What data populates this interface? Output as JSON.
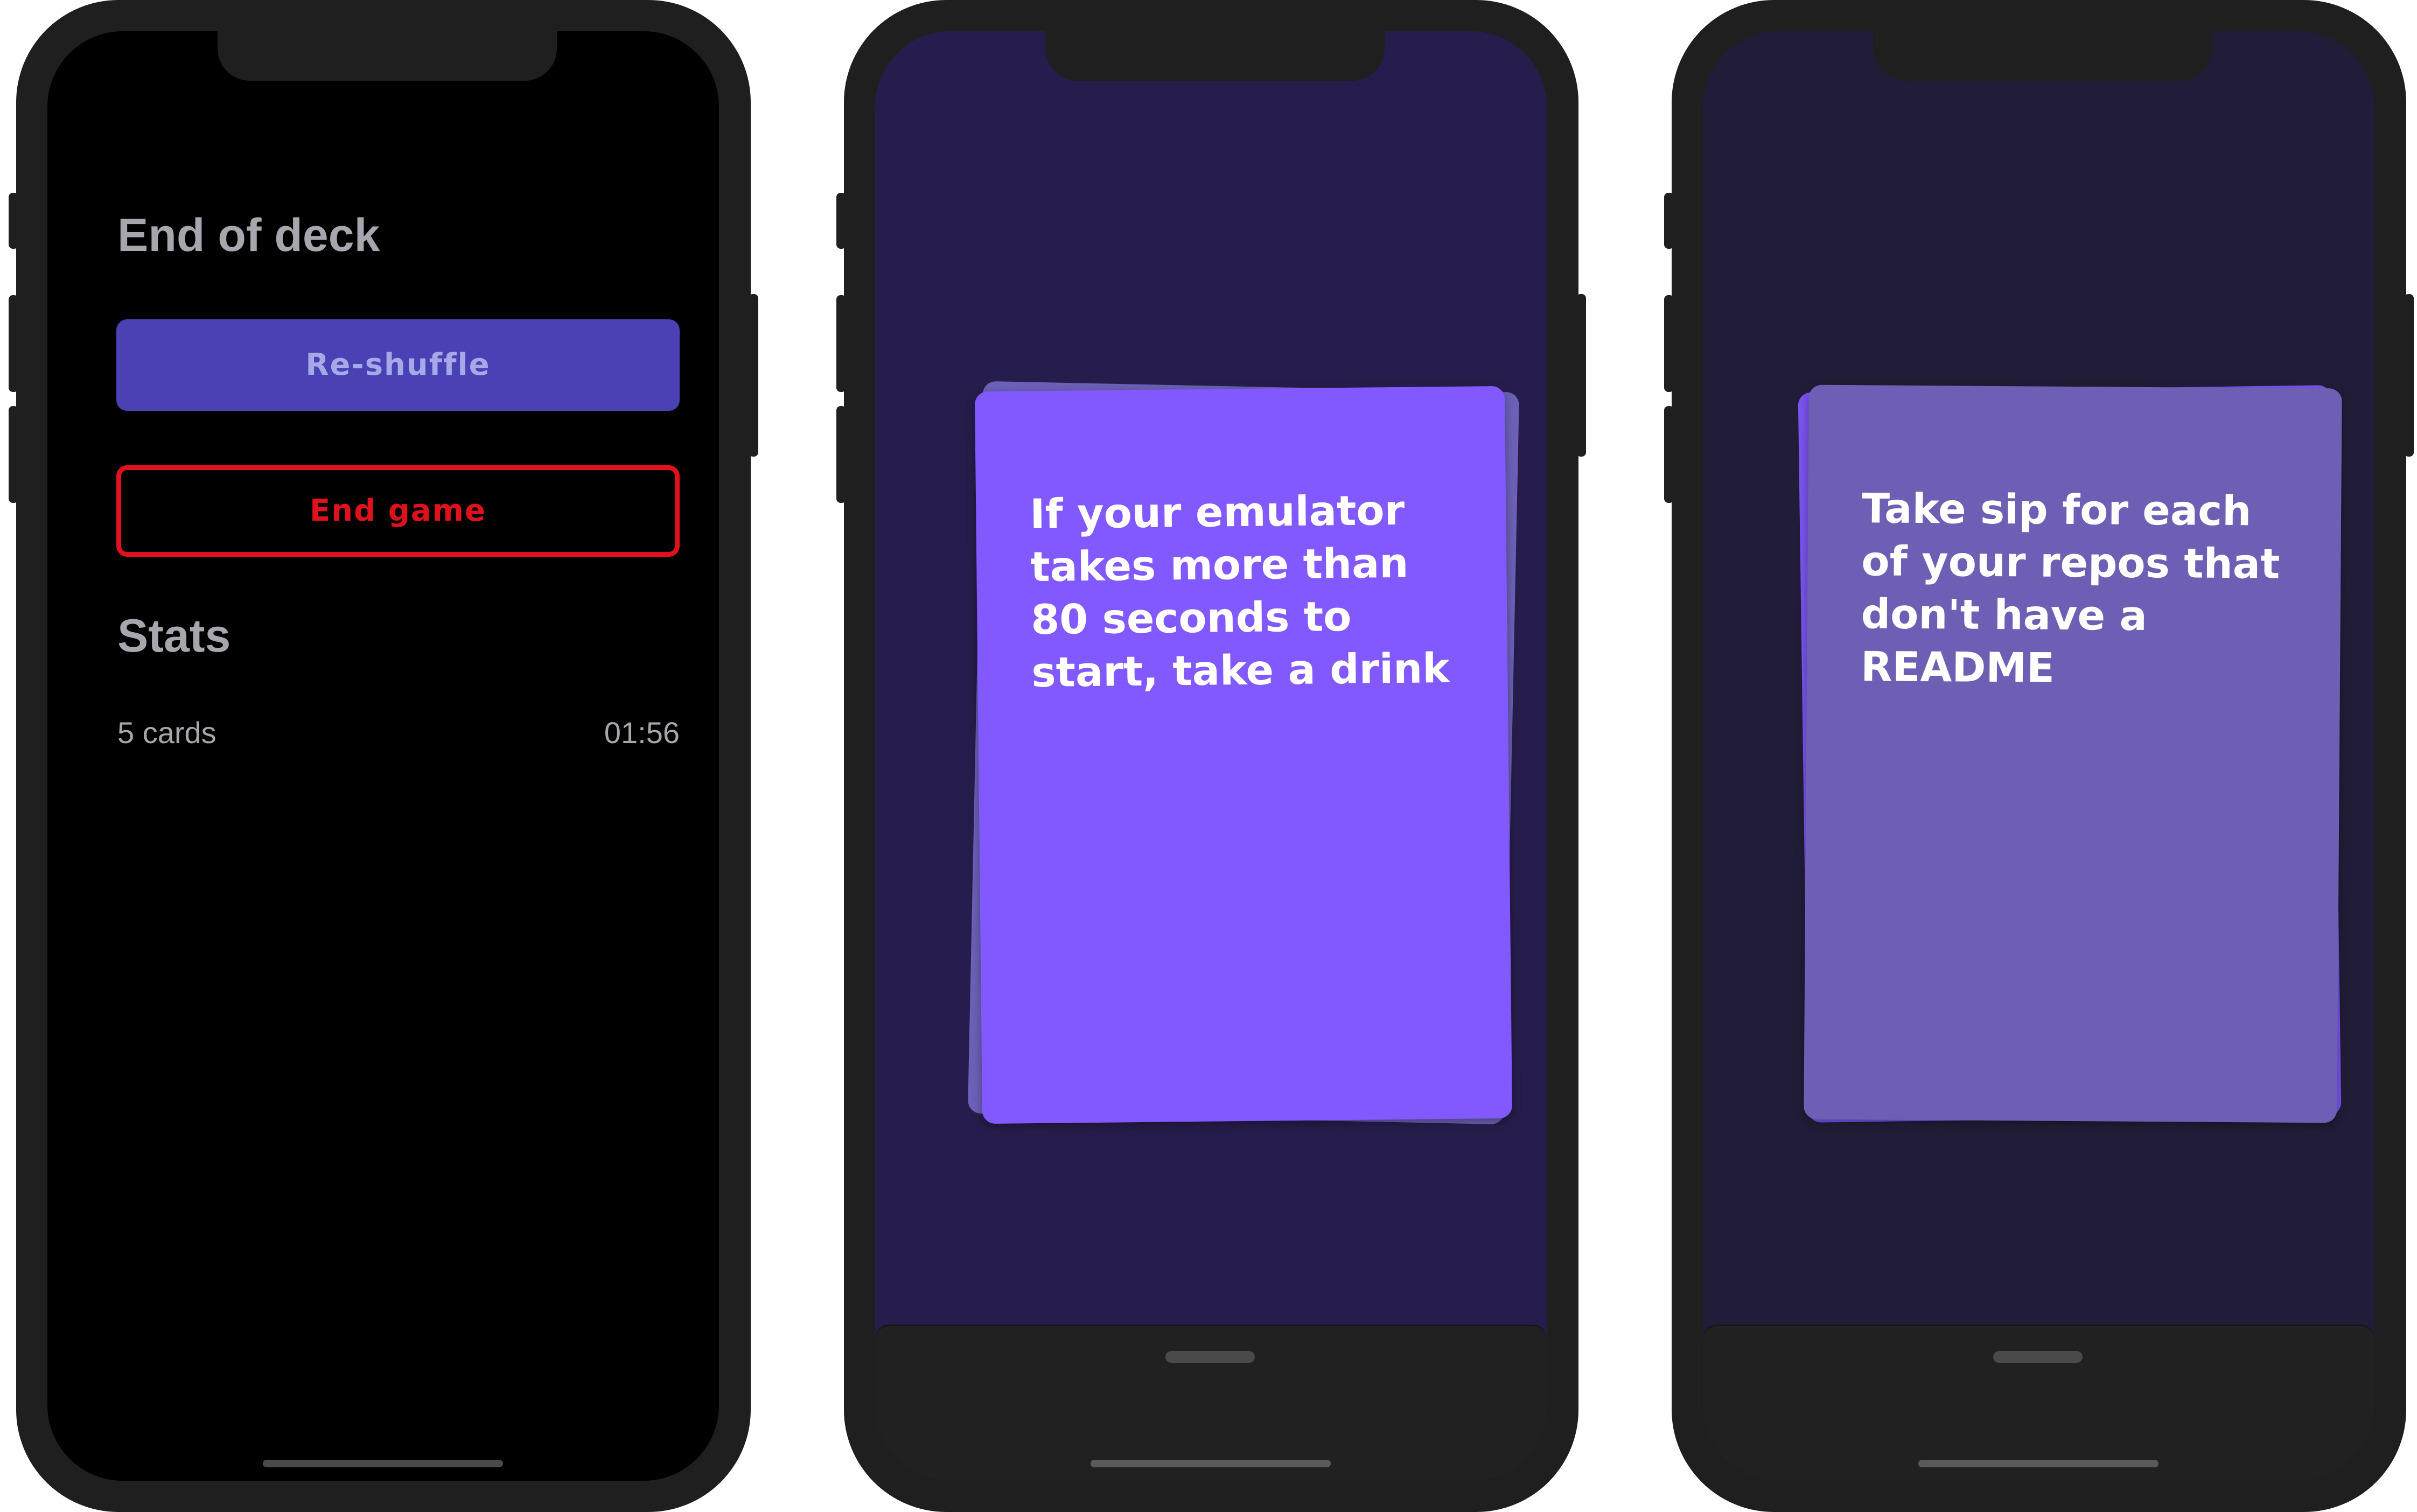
{
  "screens": {
    "end_of_deck": {
      "title": "End of deck",
      "reshuffle_label": "Re-shuffle",
      "end_game_label": "End game",
      "stats_title": "Stats",
      "cards_count": "5 cards",
      "elapsed_time": "01:56"
    },
    "card_prompt_1": {
      "text": "If your emulator takes more than 80 seconds to start, take a drink"
    },
    "card_prompt_2": {
      "text": "Take sip for each of your repos that don't have a README"
    }
  },
  "colors": {
    "phone_frame": "#1f1f1f",
    "screen_end_bg": "#000000",
    "heading_text": "#a6a6ae",
    "reshuffle_bg": "#4a41b5",
    "reshuffle_text": "#a6a8e8",
    "end_game_red": "#e0101c",
    "screen2_bg": "#271d4c",
    "screen3_bg": "#211d38",
    "card_active": "#8259ff",
    "card_muted": "#6f5fb4",
    "card_back_muted": "#6a5cae",
    "bottom_sheet": "#212121"
  }
}
